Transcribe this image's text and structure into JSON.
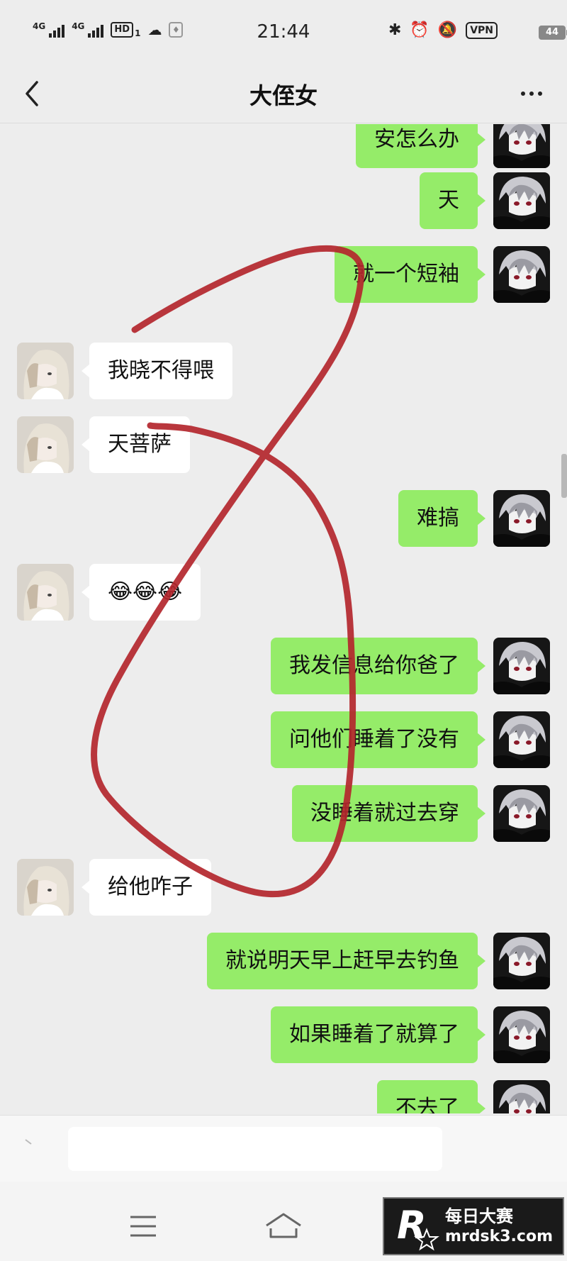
{
  "status_bar": {
    "net1": "4G",
    "net2": "4G",
    "hd": "HD",
    "hd_sub": "1",
    "time": "21:44",
    "vpn": "VPN",
    "battery": "44"
  },
  "header": {
    "title": "大侄女"
  },
  "messages": [
    {
      "side": "right",
      "text": "安怎么办"
    },
    {
      "side": "right",
      "text": "天"
    },
    {
      "side": "right",
      "text": "就一个短袖"
    },
    {
      "side": "left",
      "text": "我晓不得喂"
    },
    {
      "side": "left",
      "text": "天菩萨"
    },
    {
      "side": "right",
      "text": "难搞"
    },
    {
      "side": "left",
      "text": "😂😂😂"
    },
    {
      "side": "right",
      "text": "我发信息给你爸了"
    },
    {
      "side": "right",
      "text": "问他们睡着了没有"
    },
    {
      "side": "right",
      "text": "没睡着就过去穿"
    },
    {
      "side": "left",
      "text": "给他咋子"
    },
    {
      "side": "right",
      "text": "就说明天早上赶早去钓鱼"
    },
    {
      "side": "right",
      "text": "如果睡着了就算了"
    },
    {
      "side": "right",
      "text": "不去了"
    }
  ],
  "watermark": {
    "cn": "每日大赛",
    "url": "mrdsk3.com"
  },
  "colors": {
    "background": "#ededed",
    "sent_bubble": "#95ec69",
    "received_bubble": "#ffffff",
    "scribble": "#b3262c"
  }
}
